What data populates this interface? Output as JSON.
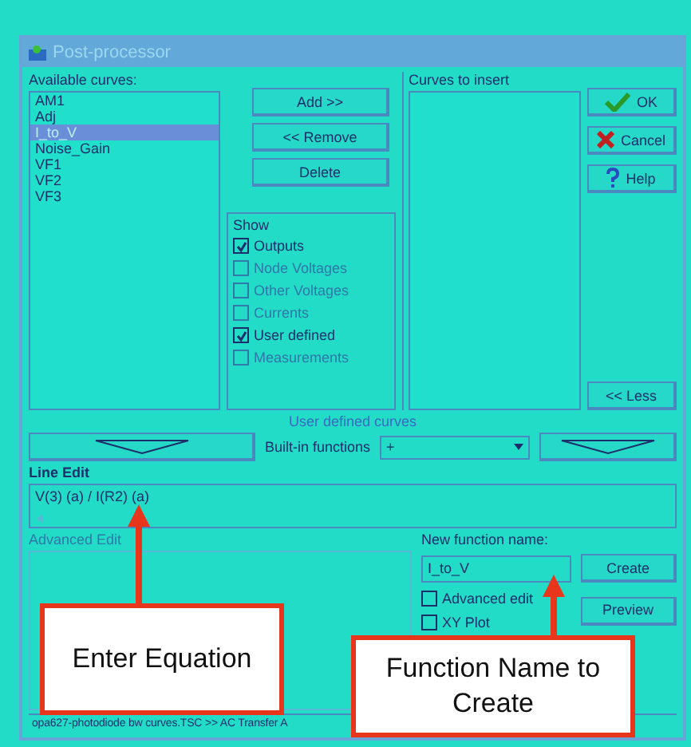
{
  "window": {
    "title": "Post-processor"
  },
  "available_curves": {
    "label": "Available curves:",
    "items": [
      {
        "label": "AM1",
        "selected": false
      },
      {
        "label": "Adj",
        "selected": false
      },
      {
        "label": "I_to_V",
        "selected": true
      },
      {
        "label": "Noise_Gain",
        "selected": false
      },
      {
        "label": "VF1",
        "selected": false
      },
      {
        "label": "VF2",
        "selected": false
      },
      {
        "label": "VF3",
        "selected": false
      }
    ]
  },
  "list_buttons": [
    "Add >>",
    "<< Remove",
    "Delete"
  ],
  "show": {
    "title": "Show",
    "options": [
      {
        "label": "Outputs",
        "checked": true,
        "disabled": false
      },
      {
        "label": "Node Voltages",
        "checked": false,
        "disabled": true
      },
      {
        "label": "Other Voltages",
        "checked": false,
        "disabled": true
      },
      {
        "label": "Currents",
        "checked": false,
        "disabled": true
      },
      {
        "label": "User defined",
        "checked": true,
        "disabled": false
      },
      {
        "label": "Measurements",
        "checked": false,
        "disabled": true
      }
    ]
  },
  "curves_to_insert": {
    "label": "Curves to insert"
  },
  "dialog_buttons": [
    {
      "kind": "ok",
      "label": "OK"
    },
    {
      "kind": "cancel",
      "label": "Cancel"
    },
    {
      "kind": "help",
      "label": "Help"
    }
  ],
  "less_button": "<< Less",
  "user_defined_curves": {
    "title": "User defined curves",
    "builtin_label": "Built-in functions",
    "builtin_value": "+"
  },
  "line_edit": {
    "label": "Line Edit",
    "value": "V(3) (a) / I(R2) (a)"
  },
  "advanced_edit": {
    "label": "Advanced Edit",
    "disabled": true
  },
  "new_function": {
    "label": "New function name:",
    "value": "I_to_V",
    "buttons": [
      "Create",
      "Preview"
    ],
    "options": [
      {
        "label": "Advanced edit",
        "checked": false
      },
      {
        "label": "XY Plot",
        "checked": false
      }
    ]
  },
  "status_bar": "opa627-photodiode bw curves.TSC >> AC Transfer A",
  "annotations": [
    {
      "text": "Enter Equation"
    },
    {
      "text": "Function Name to Create"
    }
  ]
}
